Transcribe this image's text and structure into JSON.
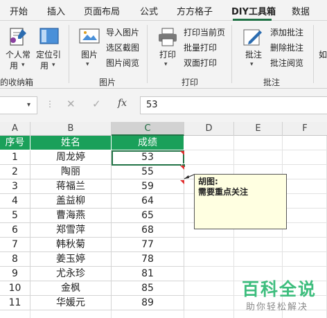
{
  "menu": {
    "tabs": [
      "开始",
      "插入",
      "页面布局",
      "公式",
      "方方格子",
      "DIY工具箱",
      "数据"
    ],
    "active": "DIY工具箱"
  },
  "ribbon": {
    "groups": {
      "favorites": {
        "label": "的收纳箱",
        "personal_btn": "个人常",
        "personal_sub": "用",
        "locate_btn": "定位引",
        "locate_sub": "用"
      },
      "picture": {
        "label": "图片",
        "big_btn": "图片",
        "small": [
          "导入图片",
          "选区截图",
          "图片阅览"
        ]
      },
      "print": {
        "label": "打印",
        "big_btn": "打印",
        "small": [
          "打印当前页",
          "批量打印",
          "双面打印"
        ]
      },
      "comment": {
        "label": "批注",
        "big_btn": "批注",
        "small": [
          "添加批注",
          "删除批注",
          "批注阅览"
        ]
      }
    },
    "cut_label": "如"
  },
  "formula_bar": {
    "cancel": "✕",
    "confirm": "✓",
    "fx": "fx",
    "value": "53"
  },
  "sheet": {
    "columns": [
      "A",
      "B",
      "C",
      "D",
      "E",
      "F"
    ],
    "rows": [
      [
        "序号",
        "姓名",
        "成绩"
      ],
      [
        "1",
        "周龙婷",
        "53"
      ],
      [
        "2",
        "陶丽",
        "55"
      ],
      [
        "3",
        "蒋福兰",
        "59"
      ],
      [
        "4",
        "盖益柳",
        "64"
      ],
      [
        "5",
        "曹海燕",
        "65"
      ],
      [
        "6",
        "郑雪萍",
        "68"
      ],
      [
        "7",
        "韩秋菊",
        "77"
      ],
      [
        "8",
        "姜玉婷",
        "78"
      ],
      [
        "9",
        "尤永珍",
        "81"
      ],
      [
        "10",
        "金枫",
        "85"
      ],
      [
        "11",
        "华媛元",
        "89"
      ]
    ]
  },
  "comment": {
    "author": "胡图:",
    "text": "需要重点关注"
  },
  "watermark": {
    "title": "百科全说",
    "subtitle": "助你轻松解决"
  },
  "colors": {
    "accent": "#217346",
    "header_fill": "#1aa05a",
    "comment_bg": "#ffffe1",
    "indicator": "#e03030"
  }
}
